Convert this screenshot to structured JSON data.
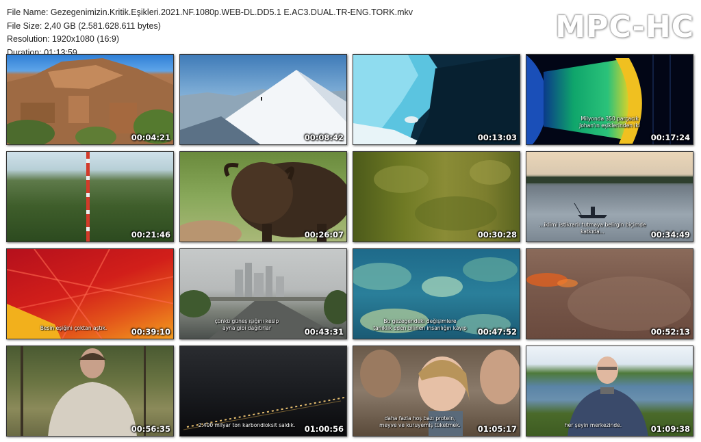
{
  "info": {
    "file_name": "File Name: Gezegenimizin.Kritik.Eşikleri.2021.NF.1080p.WEB-DL.DD5.1 E.AC3.DUAL.TR-ENG.TORK.mkv",
    "file_size": "File Size: 2,40 GB (2.581.628.611 bytes)",
    "resolution": "Resolution: 1920x1080 (16:9)",
    "duration": "Duration: 01:13:59"
  },
  "logo": "MPC-HC",
  "thumbnails": [
    {
      "time": "00:04:21",
      "subtitle": ""
    },
    {
      "time": "00:08:42",
      "subtitle": ""
    },
    {
      "time": "00:13:03",
      "subtitle": ""
    },
    {
      "time": "00:17:24",
      "subtitle": "Milyonda 350 parçacık\nJohan'ın eşiklerinden iki"
    },
    {
      "time": "00:21:46",
      "subtitle": ""
    },
    {
      "time": "00:26:07",
      "subtitle": ""
    },
    {
      "time": "00:30:28",
      "subtitle": ""
    },
    {
      "time": "00:34:49",
      "subtitle": "...iklimi istikrarlı tutmaya belirgin biçimde katkıda..."
    },
    {
      "time": "00:39:10",
      "subtitle": "Besin eşiğini çoktan aştık."
    },
    {
      "time": "00:43:31",
      "subtitle": "çünkü güneş ışığını kesip\nayna gibi dağıtırlar"
    },
    {
      "time": "00:47:52",
      "subtitle": "Bu gezegendeki değişimlere\ntanıklık eden bilinen insanlığın kayıp"
    },
    {
      "time": "00:52:13",
      "subtitle": ""
    },
    {
      "time": "00:56:35",
      "subtitle": ""
    },
    {
      "time": "01:00:56",
      "subtitle": "2.400 milyar ton karbondioksit saldık."
    },
    {
      "time": "01:05:17",
      "subtitle": "daha fazla hoş bazı protein,\nmeyve ve kuruyemiş tüketmek."
    },
    {
      "time": "01:09:38",
      "subtitle": "her şeyin merkezinde."
    }
  ]
}
